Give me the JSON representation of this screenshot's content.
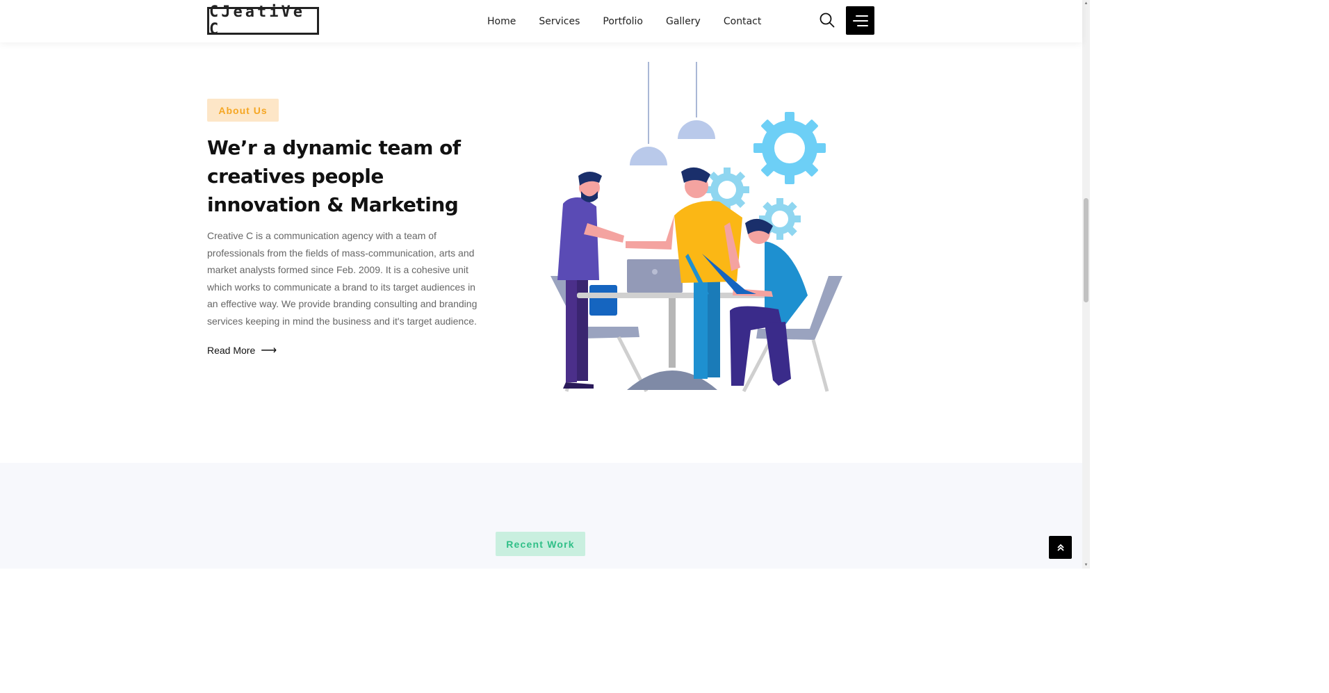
{
  "header": {
    "logo_text": "CJeatiVe C",
    "nav": [
      "Home",
      "Services",
      "Portfolio",
      "Gallery",
      "Contact"
    ],
    "search_icon": "search-icon",
    "menu_icon": "hamburger-menu-icon"
  },
  "about": {
    "badge": "About Us",
    "title": "We’r a dynamic team of creatives people innovation & Marketing",
    "text": "Creative C is a communication agency with a team of professionals from the fields of mass-communication, arts and market analysts formed since Feb. 2009. It is a cohesive unit which works to communicate a brand to its target audiences in an effective way. We provide branding consulting and branding services keeping in mind the business and it's target audience.",
    "read_more": "Read More",
    "read_more_arrow": "⟶",
    "illustration": "team-handshake-illustration"
  },
  "recent": {
    "badge": "Recent Work"
  },
  "scroll_top_icon": "⌃",
  "colors": {
    "about_badge_bg": "#fde6c7",
    "about_badge_text": "#f5a623",
    "recent_badge_bg": "#c9efdf",
    "recent_badge_text": "#2fbf87",
    "gear": "#6dcff6",
    "shirt_purple": "#5a4bb5",
    "shirt_yellow": "#fbb715",
    "shirt_blue": "#1e90d0"
  }
}
